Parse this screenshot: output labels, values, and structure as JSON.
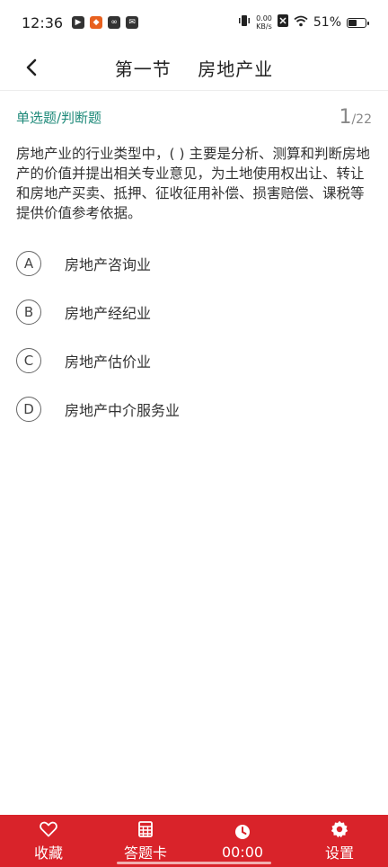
{
  "status_bar": {
    "time": "12:36",
    "net_speed_value": "0.00",
    "net_speed_unit": "KB/s",
    "battery": "51%"
  },
  "header": {
    "title": "第一节    房地产业"
  },
  "question": {
    "type": "单选题/判断题",
    "current": "1",
    "total": "/22",
    "text": "房地产业的行业类型中，( ) 主要是分析、测算和判断房地产的价值并提出相关专业意见，为土地使用权出让、转让和房地产买卖、抵押、征收征用补偿、损害赔偿、课税等提供价值参考依据。",
    "options": [
      {
        "letter": "A",
        "text": "房地产咨询业"
      },
      {
        "letter": "B",
        "text": "房地产经纪业"
      },
      {
        "letter": "C",
        "text": "房地产估价业"
      },
      {
        "letter": "D",
        "text": "房地产中介服务业"
      }
    ]
  },
  "bottom_bar": {
    "favorite_label": "收藏",
    "answer_card_label": "答题卡",
    "timer_label": "00:00",
    "settings_label": "设置"
  },
  "colors": {
    "accent": "#d9232a",
    "type_text": "#1f8a7a"
  }
}
